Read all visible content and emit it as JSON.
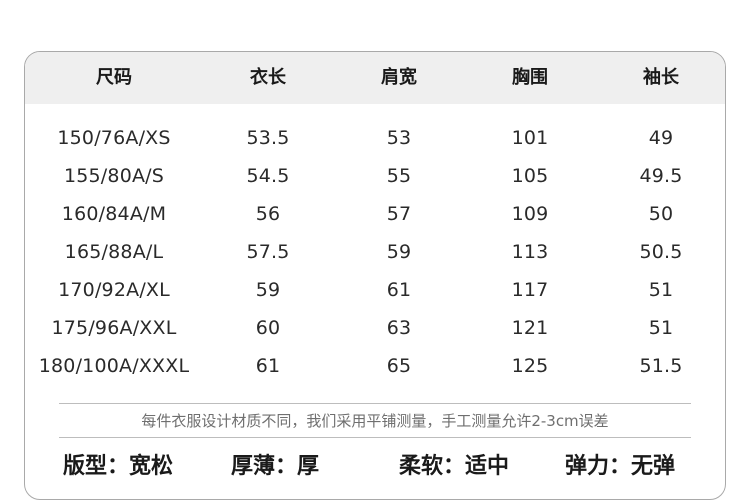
{
  "table": {
    "headers": [
      "尺码",
      "衣长",
      "肩宽",
      "胸围",
      "袖长"
    ],
    "rows": [
      [
        "150/76A/XS",
        "53.5",
        "53",
        "101",
        "49"
      ],
      [
        "155/80A/S",
        "54.5",
        "55",
        "105",
        "49.5"
      ],
      [
        "160/84A/M",
        "56",
        "57",
        "109",
        "50"
      ],
      [
        "165/88A/L",
        "57.5",
        "59",
        "113",
        "50.5"
      ],
      [
        "170/92A/XL",
        "59",
        "61",
        "117",
        "51"
      ],
      [
        "175/96A/XXL",
        "60",
        "63",
        "121",
        "51"
      ],
      [
        "180/100A/XXXL",
        "61",
        "65",
        "125",
        "51.5"
      ]
    ]
  },
  "note": "每件衣服设计材质不同，我们采用平铺测量，手工测量允许2-3cm误差",
  "attributes": [
    {
      "label": "版型：宽松"
    },
    {
      "label": "厚薄：厚"
    },
    {
      "label": "柔软：适中"
    },
    {
      "label": "弹力：无弹"
    }
  ],
  "colors": {
    "header_bg": "#efefef",
    "border": "#a9a9a9",
    "note_text": "#6f6f6f"
  }
}
